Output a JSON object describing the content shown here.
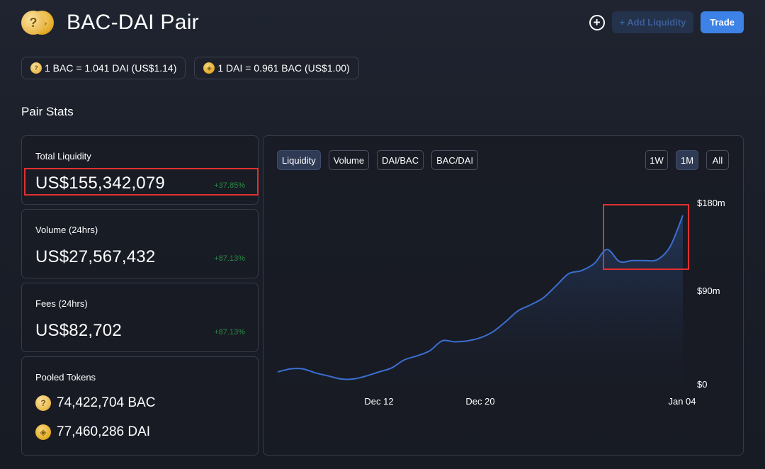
{
  "header": {
    "title": "BAC-DAI Pair",
    "add_liquidity": "+ Add Liquidity",
    "trade": "Trade"
  },
  "rates": [
    {
      "text": "1 BAC = 1.041 DAI (US$1.14)",
      "icon": "bac-coin-icon"
    },
    {
      "text": "1 DAI = 0.961 BAC (US$1.00)",
      "icon": "dai-coin-icon"
    }
  ],
  "stats": {
    "section_title": "Pair Stats",
    "total_liquidity": {
      "label": "Total Liquidity",
      "value": "US$155,342,079",
      "change": "+37.85%"
    },
    "volume": {
      "label": "Volume (24hrs)",
      "value": "US$27,567,432",
      "change": "+87.13%"
    },
    "fees": {
      "label": "Fees (24hrs)",
      "value": "US$82,702",
      "change": "+87.13%"
    },
    "pooled": {
      "label": "Pooled Tokens",
      "tokens": [
        {
          "text": "74,422,704 BAC",
          "icon": "bac-coin-icon"
        },
        {
          "text": "77,460,286 DAI",
          "icon": "dai-coin-icon"
        }
      ]
    }
  },
  "chart": {
    "tabs": [
      "Liquidity",
      "Volume",
      "DAI/BAC",
      "BAC/DAI"
    ],
    "active_tab": "Liquidity",
    "ranges": [
      "1W",
      "1M",
      "All"
    ],
    "active_range": "1M"
  },
  "colors": {
    "accent": "#3d82e6",
    "positive": "#2a8a44",
    "highlight": "#e23030",
    "line": "#3a6fd0"
  },
  "chart_data": {
    "type": "area",
    "title": "",
    "xlabel": "",
    "ylabel": "",
    "x_ticks": [
      "Dec 12",
      "Dec 20",
      "Jan 04"
    ],
    "y_ticks": [
      "$180m",
      "$90m",
      "$0"
    ],
    "ylim": [
      0,
      180
    ],
    "y_unit": "million USD",
    "x": [
      0,
      1,
      2,
      3,
      4,
      5,
      6,
      7,
      8,
      9,
      10,
      11,
      12,
      13,
      14,
      15,
      16,
      17,
      18,
      19,
      20,
      21,
      22,
      23,
      24,
      25,
      26,
      27,
      28,
      29,
      30,
      31,
      32
    ],
    "series": [
      {
        "values": [
          12,
          15,
          15,
          11,
          8,
          5,
          5,
          8,
          12,
          16,
          24,
          28,
          33,
          43,
          42,
          43,
          46,
          52,
          62,
          73,
          79,
          86,
          98,
          110,
          113,
          120,
          134,
          122,
          123,
          123,
          124,
          137,
          168
        ]
      }
    ],
    "grid": false,
    "legend": "none"
  }
}
